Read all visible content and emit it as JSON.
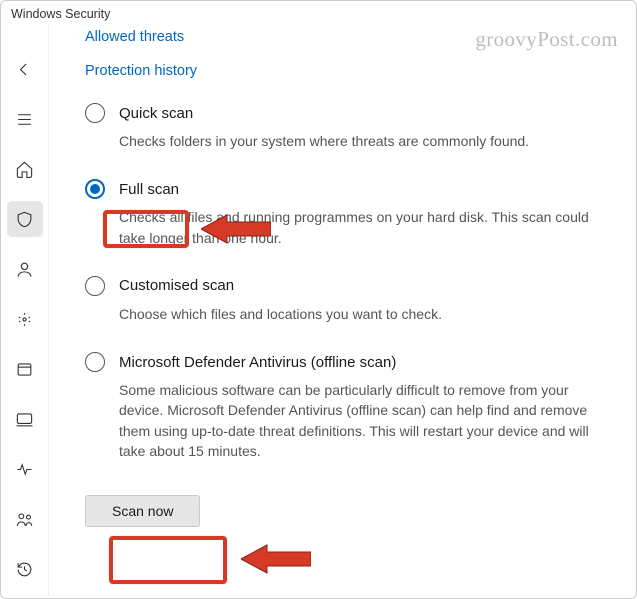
{
  "window": {
    "title": "Windows Security"
  },
  "watermark": "groovyPost.com",
  "sidebar": {
    "items": [
      {
        "name": "back-icon"
      },
      {
        "name": "menu-icon"
      },
      {
        "name": "home-icon"
      },
      {
        "name": "shield-icon",
        "active": true
      },
      {
        "name": "account-icon"
      },
      {
        "name": "firewall-icon"
      },
      {
        "name": "app-browser-icon"
      },
      {
        "name": "device-security-icon"
      },
      {
        "name": "device-performance-icon"
      },
      {
        "name": "family-icon"
      },
      {
        "name": "history-icon"
      }
    ]
  },
  "links": {
    "allowed_threats": "Allowed threats",
    "protection_history": "Protection history"
  },
  "options": [
    {
      "id": "quick",
      "label": "Quick scan",
      "checked": false,
      "desc": "Checks folders in your system where threats are commonly found."
    },
    {
      "id": "full",
      "label": "Full scan",
      "checked": true,
      "desc": "Checks all files and running programmes on your hard disk. This scan could take longer than one hour."
    },
    {
      "id": "custom",
      "label": "Customised scan",
      "checked": false,
      "desc": "Choose which files and locations you want to check."
    },
    {
      "id": "offline",
      "label": "Microsoft Defender Antivirus (offline scan)",
      "checked": false,
      "desc": "Some malicious software can be particularly difficult to remove from your device. Microsoft Defender Antivirus (offline scan) can help find and remove them using up-to-date threat definitions. This will restart your device and will take about 15 minutes."
    }
  ],
  "button": {
    "scan_now": "Scan now"
  },
  "annotations": {
    "highlight_option": "full",
    "highlight_button": true,
    "color": "#d63a27"
  }
}
